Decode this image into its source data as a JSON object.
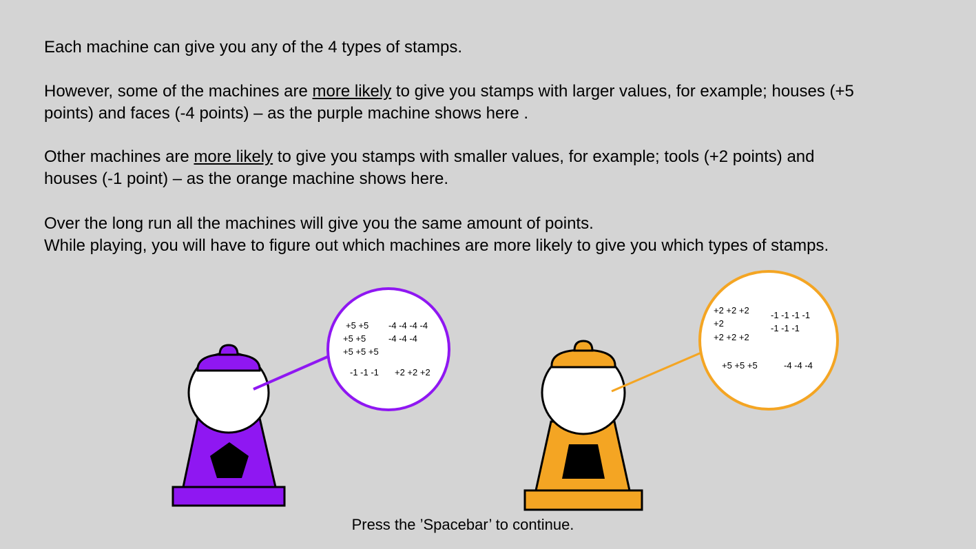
{
  "instructions": {
    "p1": "Each machine can give you any of the 4 types of stamps.",
    "p2_before": "However, some of the machines are ",
    "p2_underline": "more likely",
    "p2_after_line1": " to give you stamps with larger values, for example; houses (+5",
    "p2_line2": "points) and faces (-4 points) – as the purple machine shows here .",
    "p3_before": "Other machines are ",
    "p3_underline": "more likely",
    "p3_after_line1": " to give you stamps with smaller values, for example; tools (+2 points) and",
    "p3_line2": "houses (-1 point) – as the orange machine shows here.",
    "p4_line1": "Over the long run all the machines will give you the same amount of points.",
    "p4_line2": "While playing, you will have to figure out which machines are more likely to give you which types of stamps."
  },
  "machines": {
    "purple": {
      "color": "#8f17f2",
      "window_shape": "pentagon",
      "bubble_lines": [
        "+5 +5",
        "-4 -4 -4 -4",
        "+5 +5",
        "-4 -4 -4",
        "+5 +5 +5",
        "-1 -1 -1",
        "+2 +2 +2"
      ]
    },
    "orange": {
      "color": "#f4a523",
      "window_shape": "trapezoid",
      "bubble_lines": [
        "+2 +2 +2",
        "-1 -1 -1 -1",
        "+2",
        "-1 -1 -1",
        "+2 +2 +2",
        "+5 +5 +5",
        "-4 -4 -4"
      ]
    }
  },
  "footer": {
    "continue_text": "Press the ’Spacebar’ to continue."
  }
}
